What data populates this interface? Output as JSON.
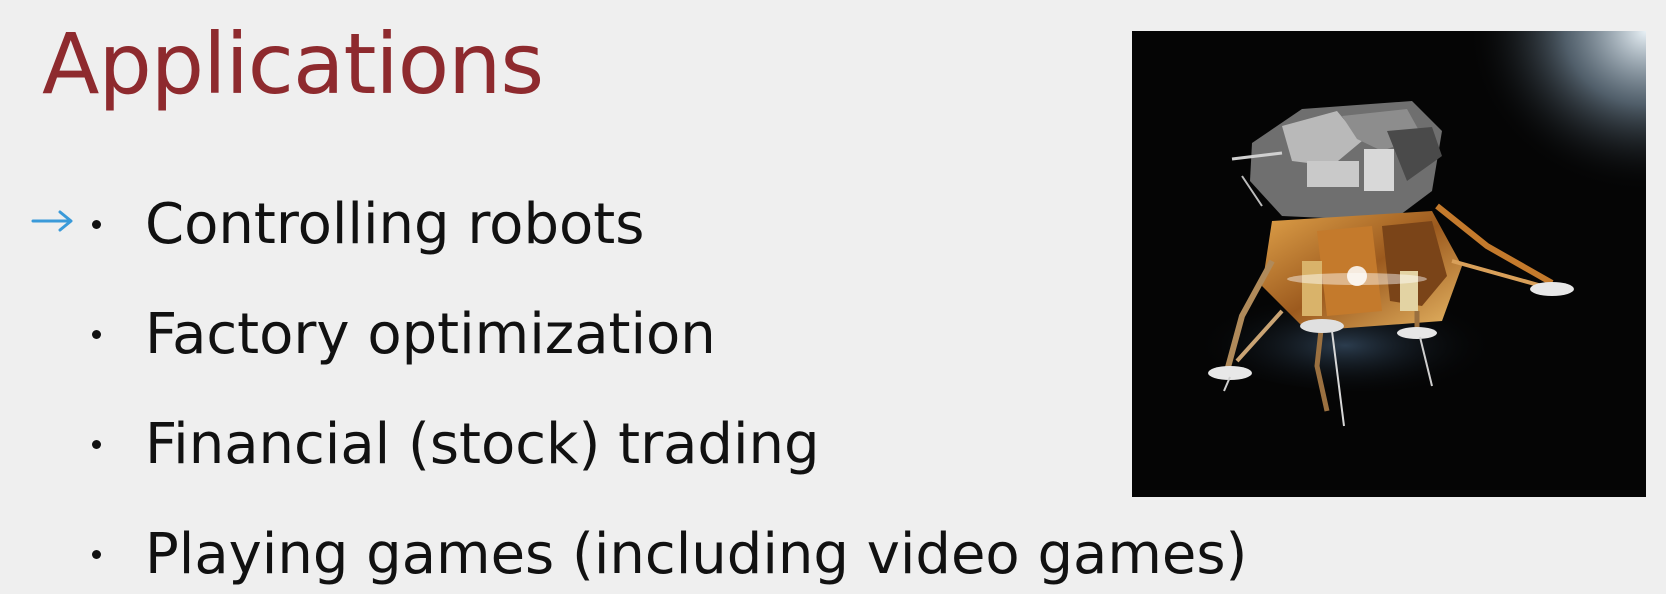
{
  "slide": {
    "title": "Applications",
    "title_color": "#8e2a2e",
    "pointer_icon": "arrow-right-icon",
    "pointer_color": "#3a9ad9",
    "bullets": [
      "Controlling robots",
      "Factory optimization",
      "Financial (stock) trading",
      "Playing games (including video games)"
    ],
    "image": {
      "icon": "lunar-module-photo"
    }
  }
}
